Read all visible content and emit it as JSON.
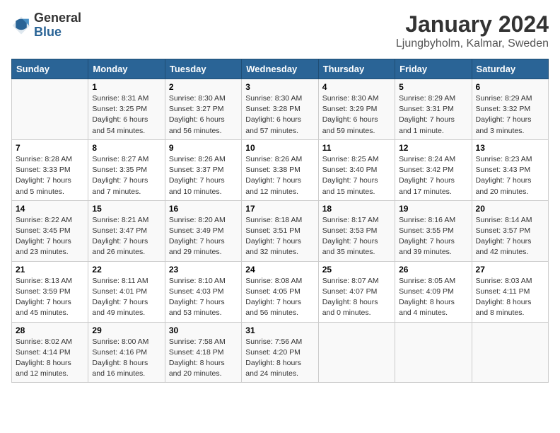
{
  "header": {
    "logo_general": "General",
    "logo_blue": "Blue",
    "title": "January 2024",
    "subtitle": "Ljungbyholm, Kalmar, Sweden"
  },
  "calendar": {
    "days_of_week": [
      "Sunday",
      "Monday",
      "Tuesday",
      "Wednesday",
      "Thursday",
      "Friday",
      "Saturday"
    ],
    "weeks": [
      [
        {
          "date": "",
          "details": ""
        },
        {
          "date": "1",
          "details": "Sunrise: 8:31 AM\nSunset: 3:25 PM\nDaylight: 6 hours\nand 54 minutes."
        },
        {
          "date": "2",
          "details": "Sunrise: 8:30 AM\nSunset: 3:27 PM\nDaylight: 6 hours\nand 56 minutes."
        },
        {
          "date": "3",
          "details": "Sunrise: 8:30 AM\nSunset: 3:28 PM\nDaylight: 6 hours\nand 57 minutes."
        },
        {
          "date": "4",
          "details": "Sunrise: 8:30 AM\nSunset: 3:29 PM\nDaylight: 6 hours\nand 59 minutes."
        },
        {
          "date": "5",
          "details": "Sunrise: 8:29 AM\nSunset: 3:31 PM\nDaylight: 7 hours\nand 1 minute."
        },
        {
          "date": "6",
          "details": "Sunrise: 8:29 AM\nSunset: 3:32 PM\nDaylight: 7 hours\nand 3 minutes."
        }
      ],
      [
        {
          "date": "7",
          "details": "Sunrise: 8:28 AM\nSunset: 3:33 PM\nDaylight: 7 hours\nand 5 minutes."
        },
        {
          "date": "8",
          "details": "Sunrise: 8:27 AM\nSunset: 3:35 PM\nDaylight: 7 hours\nand 7 minutes."
        },
        {
          "date": "9",
          "details": "Sunrise: 8:26 AM\nSunset: 3:37 PM\nDaylight: 7 hours\nand 10 minutes."
        },
        {
          "date": "10",
          "details": "Sunrise: 8:26 AM\nSunset: 3:38 PM\nDaylight: 7 hours\nand 12 minutes."
        },
        {
          "date": "11",
          "details": "Sunrise: 8:25 AM\nSunset: 3:40 PM\nDaylight: 7 hours\nand 15 minutes."
        },
        {
          "date": "12",
          "details": "Sunrise: 8:24 AM\nSunset: 3:42 PM\nDaylight: 7 hours\nand 17 minutes."
        },
        {
          "date": "13",
          "details": "Sunrise: 8:23 AM\nSunset: 3:43 PM\nDaylight: 7 hours\nand 20 minutes."
        }
      ],
      [
        {
          "date": "14",
          "details": "Sunrise: 8:22 AM\nSunset: 3:45 PM\nDaylight: 7 hours\nand 23 minutes."
        },
        {
          "date": "15",
          "details": "Sunrise: 8:21 AM\nSunset: 3:47 PM\nDaylight: 7 hours\nand 26 minutes."
        },
        {
          "date": "16",
          "details": "Sunrise: 8:20 AM\nSunset: 3:49 PM\nDaylight: 7 hours\nand 29 minutes."
        },
        {
          "date": "17",
          "details": "Sunrise: 8:18 AM\nSunset: 3:51 PM\nDaylight: 7 hours\nand 32 minutes."
        },
        {
          "date": "18",
          "details": "Sunrise: 8:17 AM\nSunset: 3:53 PM\nDaylight: 7 hours\nand 35 minutes."
        },
        {
          "date": "19",
          "details": "Sunrise: 8:16 AM\nSunset: 3:55 PM\nDaylight: 7 hours\nand 39 minutes."
        },
        {
          "date": "20",
          "details": "Sunrise: 8:14 AM\nSunset: 3:57 PM\nDaylight: 7 hours\nand 42 minutes."
        }
      ],
      [
        {
          "date": "21",
          "details": "Sunrise: 8:13 AM\nSunset: 3:59 PM\nDaylight: 7 hours\nand 45 minutes."
        },
        {
          "date": "22",
          "details": "Sunrise: 8:11 AM\nSunset: 4:01 PM\nDaylight: 7 hours\nand 49 minutes."
        },
        {
          "date": "23",
          "details": "Sunrise: 8:10 AM\nSunset: 4:03 PM\nDaylight: 7 hours\nand 53 minutes."
        },
        {
          "date": "24",
          "details": "Sunrise: 8:08 AM\nSunset: 4:05 PM\nDaylight: 7 hours\nand 56 minutes."
        },
        {
          "date": "25",
          "details": "Sunrise: 8:07 AM\nSunset: 4:07 PM\nDaylight: 8 hours\nand 0 minutes."
        },
        {
          "date": "26",
          "details": "Sunrise: 8:05 AM\nSunset: 4:09 PM\nDaylight: 8 hours\nand 4 minutes."
        },
        {
          "date": "27",
          "details": "Sunrise: 8:03 AM\nSunset: 4:11 PM\nDaylight: 8 hours\nand 8 minutes."
        }
      ],
      [
        {
          "date": "28",
          "details": "Sunrise: 8:02 AM\nSunset: 4:14 PM\nDaylight: 8 hours\nand 12 minutes."
        },
        {
          "date": "29",
          "details": "Sunrise: 8:00 AM\nSunset: 4:16 PM\nDaylight: 8 hours\nand 16 minutes."
        },
        {
          "date": "30",
          "details": "Sunrise: 7:58 AM\nSunset: 4:18 PM\nDaylight: 8 hours\nand 20 minutes."
        },
        {
          "date": "31",
          "details": "Sunrise: 7:56 AM\nSunset: 4:20 PM\nDaylight: 8 hours\nand 24 minutes."
        },
        {
          "date": "",
          "details": ""
        },
        {
          "date": "",
          "details": ""
        },
        {
          "date": "",
          "details": ""
        }
      ]
    ]
  }
}
